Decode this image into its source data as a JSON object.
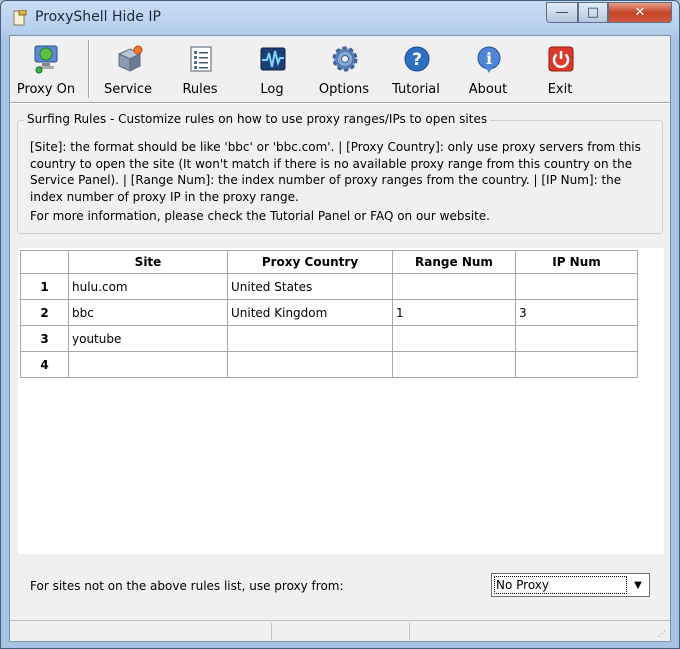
{
  "window": {
    "title": "ProxyShell Hide IP",
    "minimize": "—",
    "maximize": "□",
    "close": "✕"
  },
  "toolbar": {
    "items": [
      {
        "label": "Proxy On",
        "icon": "globe-network-icon"
      },
      {
        "label": "Service",
        "icon": "service-box-icon"
      },
      {
        "label": "Rules",
        "icon": "rules-list-icon"
      },
      {
        "label": "Log",
        "icon": "log-pulse-icon"
      },
      {
        "label": "Options",
        "icon": "gear-icon"
      },
      {
        "label": "Tutorial",
        "icon": "help-icon"
      },
      {
        "label": "About",
        "icon": "info-icon"
      },
      {
        "label": "Exit",
        "icon": "power-icon"
      }
    ]
  },
  "rules": {
    "group_title": "Surfing Rules  -  Customize rules on how to use proxy ranges/IPs to open sites",
    "description": "[Site]: the format should be like 'bbc' or 'bbc.com'. | [Proxy Country]: only use proxy servers from this country to open the site (It won't match if there is no available proxy range from this country on the Service Panel). | [Range Num]: the index number of proxy ranges from the country. | [IP Num]: the index number of proxy IP in the proxy range.",
    "more_info": "For more information, please check the Tutorial Panel or FAQ on our website."
  },
  "grid": {
    "columns": [
      "",
      "Site",
      "Proxy Country",
      "Range Num",
      "IP Num"
    ],
    "rows": [
      {
        "num": "1",
        "site": "hulu.com",
        "country": "United States",
        "range": "",
        "ip": ""
      },
      {
        "num": "2",
        "site": "bbc",
        "country": "United Kingdom",
        "range": "1",
        "ip": "3"
      },
      {
        "num": "3",
        "site": "youtube",
        "country": "",
        "range": "",
        "ip": ""
      },
      {
        "num": "4",
        "site": "",
        "country": "",
        "range": "",
        "ip": ""
      }
    ]
  },
  "footer": {
    "label": "For sites not on the above rules list, use proxy from:",
    "selected": "No Proxy"
  },
  "colors": {
    "exit_red": "#d9382b",
    "accent_blue": "#2f6fc4"
  }
}
